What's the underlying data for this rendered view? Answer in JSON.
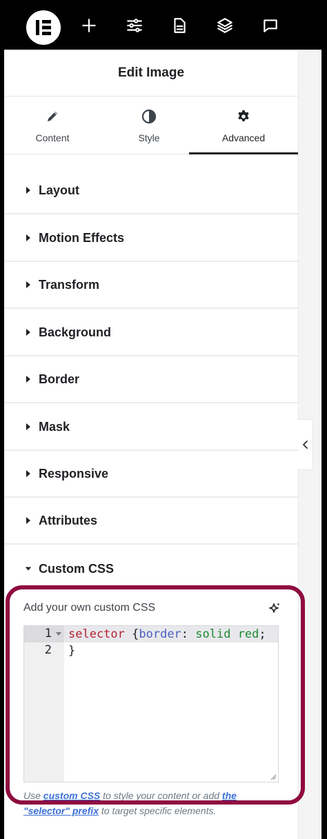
{
  "topbar": {
    "items": [
      {
        "icon": "elementor-logo-icon"
      },
      {
        "icon": "plus-icon"
      },
      {
        "icon": "sliders-icon"
      },
      {
        "icon": "page-icon"
      },
      {
        "icon": "layers-icon"
      },
      {
        "icon": "chat-icon"
      }
    ]
  },
  "panel": {
    "title": "Edit Image",
    "tabs": [
      {
        "label": "Content",
        "icon": "pencil-icon",
        "active": false
      },
      {
        "label": "Style",
        "icon": "half-circle-icon",
        "active": false
      },
      {
        "label": "Advanced",
        "icon": "gear-icon",
        "active": true
      }
    ],
    "sections": [
      {
        "label": "Layout",
        "expanded": false
      },
      {
        "label": "Motion Effects",
        "expanded": false
      },
      {
        "label": "Transform",
        "expanded": false
      },
      {
        "label": "Background",
        "expanded": false
      },
      {
        "label": "Border",
        "expanded": false
      },
      {
        "label": "Mask",
        "expanded": false
      },
      {
        "label": "Responsive",
        "expanded": false
      },
      {
        "label": "Attributes",
        "expanded": false
      },
      {
        "label": "Custom CSS",
        "expanded": true
      }
    ],
    "custom_css": {
      "label": "Add your own custom CSS",
      "ai_icon": "sparkle-icon",
      "line_numbers": [
        "1",
        "2"
      ],
      "code": {
        "selector": "selector",
        "open_brace": " {",
        "property": "border",
        "colon": ": ",
        "value": "solid red",
        "semicolon": ";",
        "close_brace": "}"
      },
      "help": {
        "prefix": "Use ",
        "link1": "custom CSS",
        "middle": " to style your content or add ",
        "link2": "the \"selector\" prefix",
        "suffix": " to target specific elements."
      }
    }
  },
  "colors": {
    "highlight_border": "#8f0b3f",
    "topbar_bg": "#000000",
    "link": "#3b6fd6"
  }
}
